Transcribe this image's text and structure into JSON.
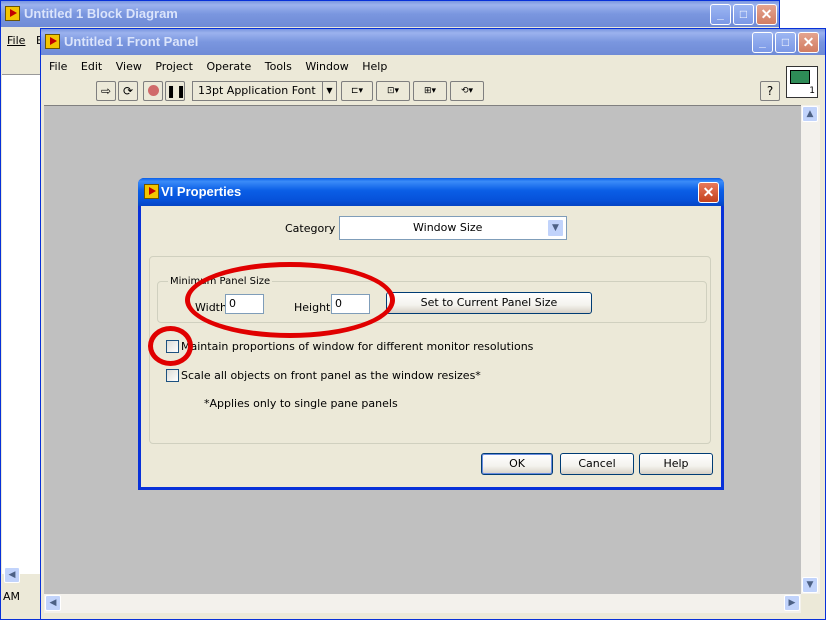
{
  "block_diagram": {
    "title": "Untitled 1 Block Diagram",
    "menu_file": "File",
    "menu_edit_partial": "E",
    "status_time_partial": "AM"
  },
  "front_panel": {
    "title": "Untitled 1 Front Panel",
    "menu": [
      "File",
      "Edit",
      "View",
      "Project",
      "Operate",
      "Tools",
      "Window",
      "Help"
    ],
    "toolbar": {
      "font_label": "13pt Application Font",
      "help_label": "?",
      "connector_badge": "1"
    }
  },
  "dialog": {
    "title": "VI Properties",
    "category_label": "Category",
    "category_value": "Window Size",
    "min_panel_size_label": "Minimum Panel Size",
    "width_label": "Width",
    "width_value": "0",
    "height_label": "Height",
    "height_value": "0",
    "set_current_label": "Set to Current Panel Size",
    "maintain_label": "Maintain proportions of window for different monitor resolutions",
    "maintain_checked": false,
    "scale_label": "Scale all objects on front panel as the window resizes*",
    "scale_checked": false,
    "footnote": "*Applies only to single pane panels",
    "ok_label": "OK",
    "cancel_label": "Cancel",
    "help_label": "Help"
  },
  "colors": {
    "xp_title_blue": "#0a5ee6",
    "panel_gray": "#c0c0c0",
    "dialog_face": "#ece9d8",
    "annotation_red": "#e00000"
  }
}
